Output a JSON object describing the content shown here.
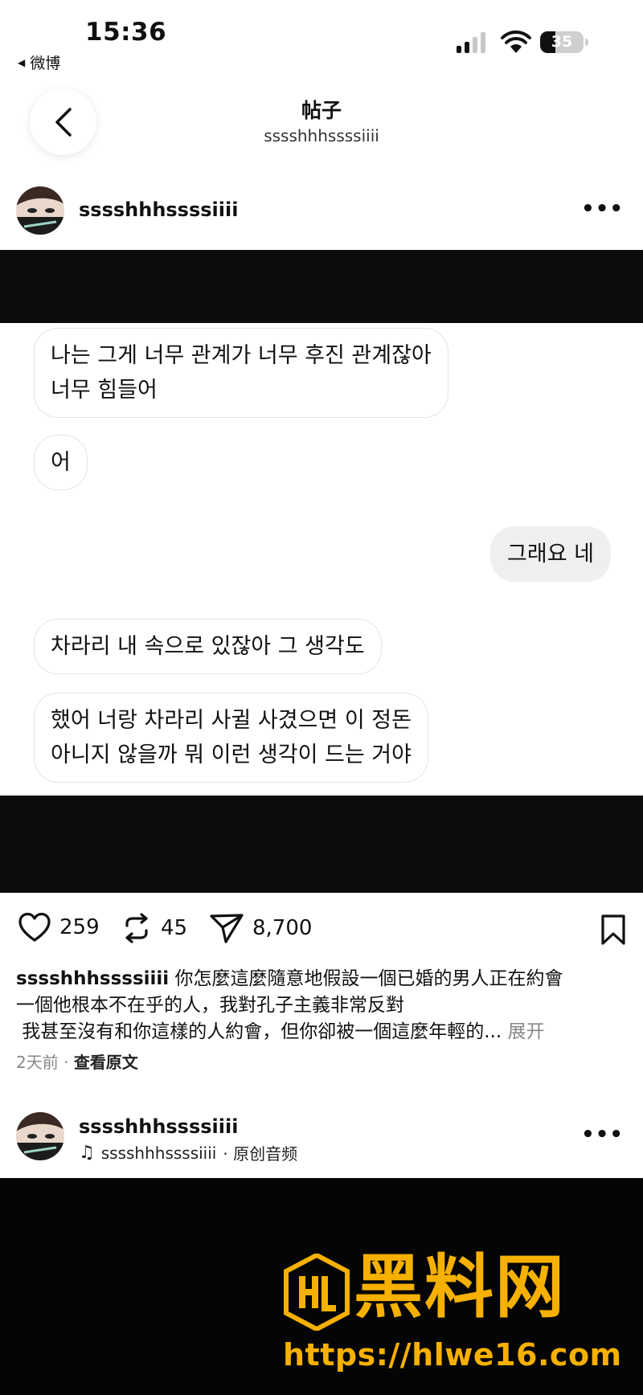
{
  "status_bar": {
    "time": "15:36",
    "back_app": "微博",
    "battery": "35"
  },
  "header": {
    "title": "帖子",
    "subtitle": "sssshhhssssiiii"
  },
  "post": {
    "author": "sssshhhssssiiii",
    "messages": [
      {
        "side": "left",
        "lines": [
          "나는 그게 너무 관계가 너무 후진 관계잖아",
          "너무 힘들어"
        ]
      },
      {
        "side": "left",
        "lines": [
          "어"
        ]
      },
      {
        "side": "right",
        "lines": [
          "그래요 네"
        ]
      },
      {
        "side": "left",
        "lines": [
          "차라리 내 속으로 있잖아 그 생각도"
        ]
      },
      {
        "side": "left",
        "lines": [
          "했어 너랑 차라리 사귈 사겼으면 이 정돈",
          "아니지 않을까 뭐 이런 생각이 드는 거야"
        ]
      }
    ],
    "likes": "259",
    "reposts": "45",
    "shares": "8,700",
    "caption_user": "sssshhhssssiiii",
    "caption_line1": "你怎麼這麼隨意地假設一個已婚的男人正在約會",
    "caption_line2": "一個他根本不在乎的人，我對孔子主義非常反對",
    "caption_line3": " 我甚至沒有和你這樣的人約會，但你卻被一個這麼年輕的...",
    "caption_more": "展开",
    "time_ago": "2天前",
    "view_original": "查看原文"
  },
  "reel": {
    "author": "sssshhhssssiiii",
    "audio": "sssshhhssssiiii",
    "audio_suffix": "· 原创音频"
  },
  "watermark": {
    "title": "黑料网",
    "url": "https://hlwe16.com"
  },
  "colors": {
    "accent": "#f6b000",
    "band": "#0c0c0d"
  }
}
